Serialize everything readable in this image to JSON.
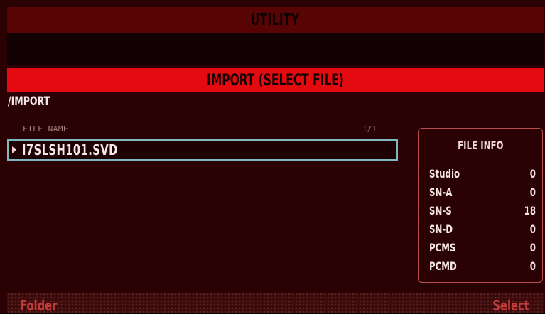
{
  "header": {
    "title": "UTILITY"
  },
  "sub_header": {
    "title": "IMPORT (SELECT FILE)"
  },
  "path": "/IMPORT",
  "file_list": {
    "column_header": "FILE NAME",
    "page_indicator": "1/1",
    "files": [
      "I7SLSH101.SVD"
    ],
    "selected_index": 0
  },
  "file_info": {
    "title": "FILE INFO",
    "rows": [
      {
        "label": "Studio",
        "value": "0"
      },
      {
        "label": "SN-A",
        "value": "0"
      },
      {
        "label": "SN-S",
        "value": "18"
      },
      {
        "label": "SN-D",
        "value": "0"
      },
      {
        "label": "PCMS",
        "value": "0"
      },
      {
        "label": "PCMD",
        "value": "0"
      }
    ]
  },
  "softkeys": {
    "left": "Folder",
    "right": "Select"
  },
  "colors": {
    "background": "#2b0203",
    "title_bar": "#580405",
    "sub_title_bar": "#e30b10",
    "selection_border": "#7fb8c0",
    "info_border": "#b85050",
    "softkey_text": "#c23a3a"
  }
}
